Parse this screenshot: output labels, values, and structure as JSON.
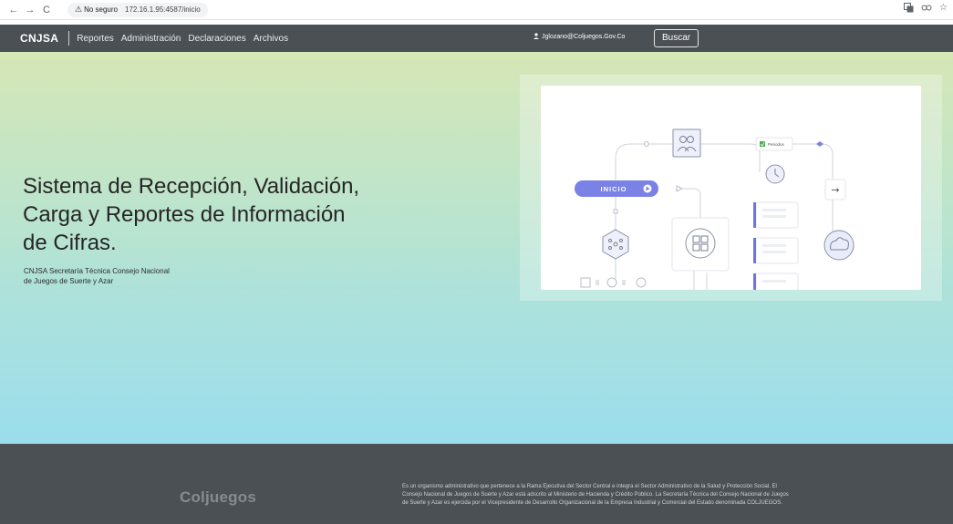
{
  "browser": {
    "back_icon": "←",
    "forward_icon": "→",
    "reload_icon": "C",
    "warning_icon": "⚠",
    "security_label": "No seguro",
    "url": "172.16.1.95:4587/inicio"
  },
  "navbar": {
    "brand": "CNJSA",
    "links": [
      "Reportes",
      "Administración",
      "Declaraciones",
      "Archivos"
    ],
    "user_email": "Jglozano@Coljuegos.Gov.Co",
    "search_label": "Buscar"
  },
  "hero": {
    "title_lines": [
      "Sistema de Recepción, Validación,",
      "Carga y Reportes de Información",
      "de Cifras."
    ],
    "subtitle_lines": [
      "CNJSA Secretaría Técnica Consejo Nacional",
      "de Juegos de Suerte y Azar"
    ]
  },
  "illustration": {
    "start_label": "INICIO",
    "periods_label": "Periodos",
    "arrow_icon": "→"
  },
  "footer": {
    "logo_text": "Coljuegos",
    "description_lines": [
      "Es un organismo administrativo que pertenece a la Rama Ejecutiva del Sector Central e integra el Sector Administrativo de la Salud y Protección Social. El",
      "Consejo Nacional de Juegos de Suerte y Azar está adscrito al Ministerio de Hacienda y Crédito Público. La Secretaría Técnica del Consejo Nacional de Juegos",
      "de Suerte y Azar es ejercida por el Vicepresidente de Desarrollo Organizacional de la Empresa Industrial y Comercial del Estado denominada COLJUEGOS."
    ]
  },
  "colors": {
    "navbar_bg": "#4b5055",
    "footer_bg": "#4b5055",
    "accent_purple": "#7b82e6"
  }
}
